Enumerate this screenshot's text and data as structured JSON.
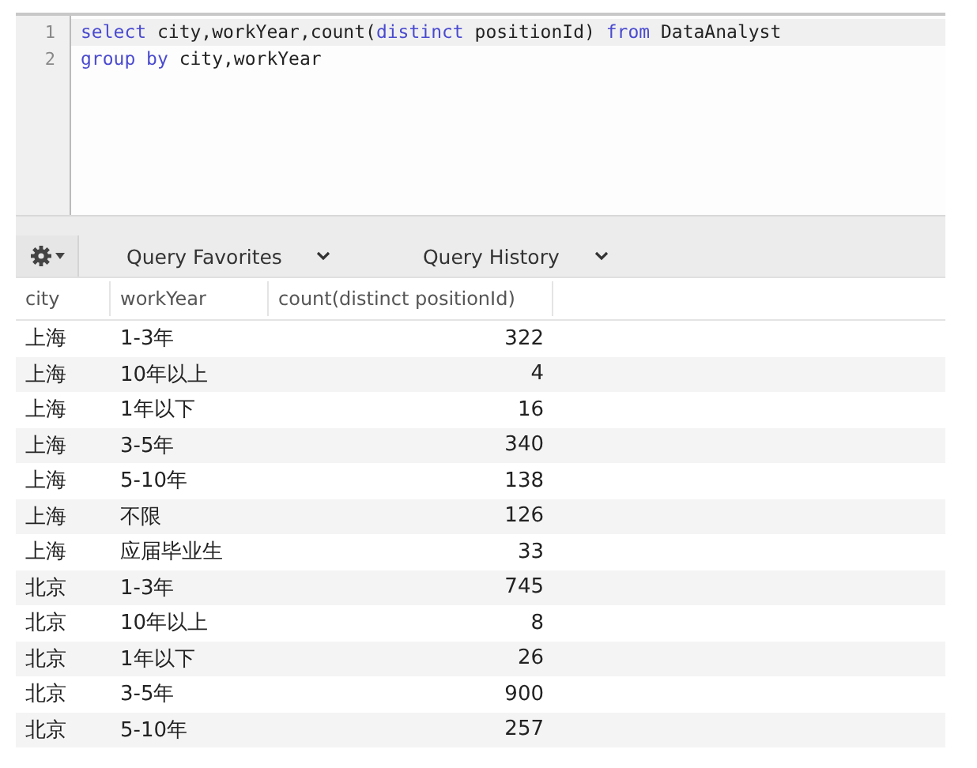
{
  "editor": {
    "lines": [
      {
        "number": "1",
        "current": true,
        "tokens": [
          {
            "text": "select",
            "kind": "keyword"
          },
          {
            "text": " city,workYear,count(",
            "kind": "plain"
          },
          {
            "text": "distinct",
            "kind": "keyword"
          },
          {
            "text": " positionId) ",
            "kind": "plain"
          },
          {
            "text": "from",
            "kind": "keyword"
          },
          {
            "text": " DataAnalyst",
            "kind": "plain"
          }
        ]
      },
      {
        "number": "2",
        "current": false,
        "tokens": [
          {
            "text": "group by",
            "kind": "keyword"
          },
          {
            "text": " city,workYear",
            "kind": "plain"
          }
        ]
      }
    ]
  },
  "toolbar": {
    "tabs": [
      {
        "label": "Query Favorites"
      },
      {
        "label": "Query History"
      }
    ]
  },
  "table": {
    "columns": [
      "city",
      "workYear",
      "count(distinct positionId)"
    ],
    "rows": [
      [
        "上海",
        "1-3年",
        "322"
      ],
      [
        "上海",
        "10年以上",
        "4"
      ],
      [
        "上海",
        "1年以下",
        "16"
      ],
      [
        "上海",
        "3-5年",
        "340"
      ],
      [
        "上海",
        "5-10年",
        "138"
      ],
      [
        "上海",
        "不限",
        "126"
      ],
      [
        "上海",
        "应届毕业生",
        "33"
      ],
      [
        "北京",
        "1-3年",
        "745"
      ],
      [
        "北京",
        "10年以上",
        "8"
      ],
      [
        "北京",
        "1年以下",
        "26"
      ],
      [
        "北京",
        "3-5年",
        "900"
      ],
      [
        "北京",
        "5-10年",
        "257"
      ]
    ]
  }
}
